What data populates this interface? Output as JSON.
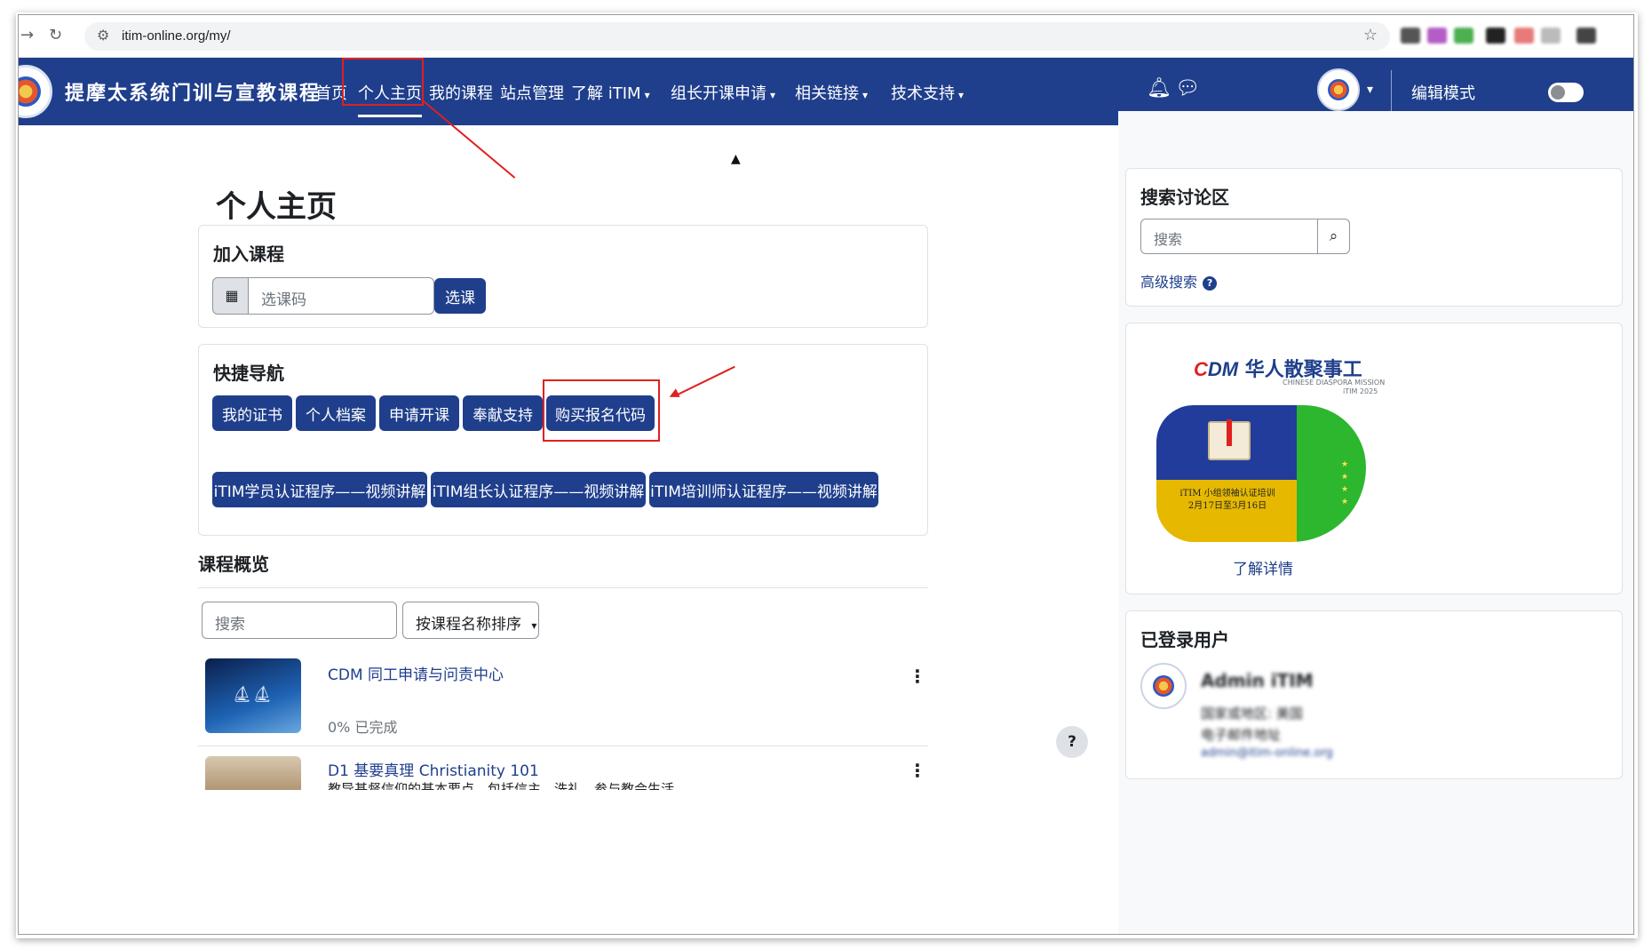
{
  "browser": {
    "url": "itim-online.org/my/"
  },
  "header": {
    "site_name": "提摩太系统门训与宣教课程",
    "nav": [
      {
        "label": "首页"
      },
      {
        "label": "个人主页"
      },
      {
        "label": "我的课程"
      },
      {
        "label": "站点管理"
      },
      {
        "label": "了解 iTIM"
      },
      {
        "label": "组长开课申请"
      },
      {
        "label": "相关链接"
      },
      {
        "label": "技术支持"
      }
    ],
    "edit_mode": "编辑模式"
  },
  "main": {
    "page_title": "个人主页",
    "join": {
      "title": "加入课程",
      "placeholder": "选课码",
      "button": "选课"
    },
    "quick_nav": {
      "title": "快捷导航",
      "row1": [
        "我的证书",
        "个人档案",
        "申请开课",
        "奉献支持",
        "购买报名代码"
      ],
      "row2": [
        "iTIM学员认证程序——视频讲解",
        "iTIM组长认证程序——视频讲解",
        "iTIM培训师认证程序——视频讲解"
      ]
    },
    "overview": {
      "title": "课程概览",
      "search_placeholder": "搜索",
      "sort_label": "按课程名称排序",
      "courses": [
        {
          "name": "CDM 同工申请与问责中心",
          "progress": "0% 已完成"
        },
        {
          "name": "D1 基要真理 Christianity 101",
          "desc": "教导基督信仰的基本要点，包括信主、洗礼、参与教会生活"
        }
      ]
    },
    "help": "?"
  },
  "drawer": {
    "forum_search": {
      "title": "搜索讨论区",
      "placeholder": "搜索",
      "advanced": "高级搜索"
    },
    "promo": {
      "logo_cn": "华人散聚事工",
      "logo_en": "CHINESE DIASPORA MISSION",
      "logo_year": "iTIM 2025",
      "caption1": "iTIM 小组领袖认证培训",
      "caption2": "2月17日至3月16日",
      "link": "了解详情"
    },
    "logged_in": {
      "title": "已登录用户",
      "name": "Admin iTIM",
      "line1": "国家或地区: 美国",
      "line2": "电子邮件地址",
      "line3": "admin@itim-online.org"
    }
  },
  "colors": {
    "brand": "#1f3f8c",
    "annotation": "#e02020"
  }
}
